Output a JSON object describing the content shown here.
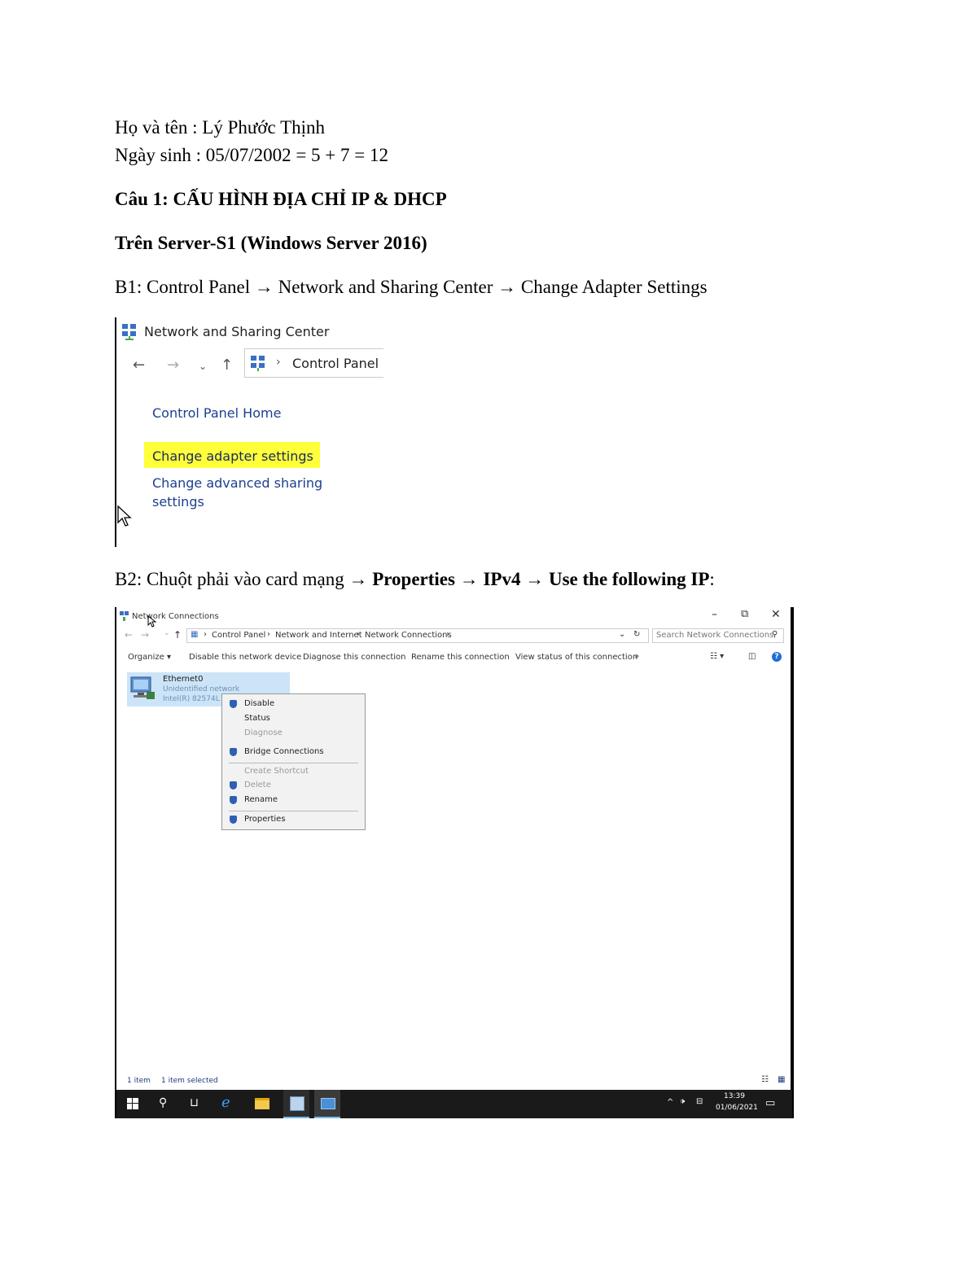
{
  "doc": {
    "name_line": "Họ và tên : Lý Phước Thịnh",
    "dob_line": "Ngày sinh : 05/07/2002 = 5 + 7 = 12",
    "question": "Câu 1: CẤU HÌNH ĐỊA CHỈ IP & DHCP",
    "server": "Trên Server-S1 (Windows Server 2016)",
    "step1": "B1: Control Panel → Network and Sharing Center → Change Adapter Settings",
    "step2_prefix": "B2: Chuột phải vào card mạng → ",
    "step2_properties": "Properties",
    "step2_arrow1": " → ",
    "step2_ipv4": "IPv4",
    "step2_arrow2": " → ",
    "step2_use": "Use the following IP",
    "step2_colon": ":"
  },
  "shot1": {
    "window_title": "Network and Sharing Center",
    "address": "Control Panel",
    "links": {
      "home": "Control Panel Home",
      "adapter": "Change adapter settings",
      "advanced_1": "Change advanced sharing",
      "advanced_2": "settings"
    },
    "highlight_color": "#ffff3a"
  },
  "shot2": {
    "window_title": "Network Connections",
    "breadcrumb": [
      "Control Panel",
      "Network and Internet",
      "Network Connections"
    ],
    "search_placeholder": "Search Network Connections",
    "toolbar": {
      "organize": "Organize ▾",
      "disable": "Disable this network device",
      "diagnose": "Diagnose this connection",
      "rename": "Rename this connection",
      "view_status": "View status of this connection",
      "more": "»"
    },
    "adapter": {
      "name": "Ethernet0",
      "status": "Unidentified network",
      "device": "Intel(R) 82574L G"
    },
    "context_menu": [
      "Disable",
      "Status",
      "Diagnose",
      "Bridge Connections",
      "Create Shortcut",
      "Delete",
      "Rename",
      "Properties"
    ],
    "statusbar": {
      "items": "1 item",
      "selected": "1 item selected"
    },
    "clock": {
      "time": "13:39",
      "date": "01/06/2021"
    }
  }
}
